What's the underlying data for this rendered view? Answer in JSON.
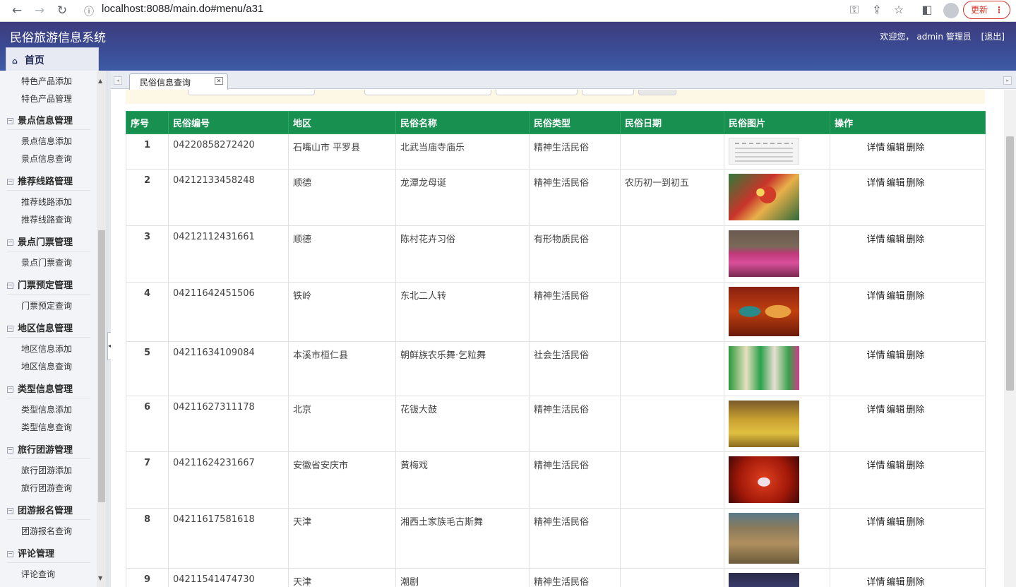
{
  "browser": {
    "url": "localhost:8088/main.do#menu/a31",
    "update_label": "更新"
  },
  "header": {
    "app_title": "民俗旅游信息系统",
    "welcome": "欢迎您，",
    "user": "admin 管理员",
    "logout": "[退出]",
    "home_tab": "首页"
  },
  "sidebar": {
    "items": [
      {
        "type": "item",
        "label": "特色产品添加"
      },
      {
        "type": "item",
        "label": "特色产品管理"
      },
      {
        "type": "group",
        "label": "景点信息管理"
      },
      {
        "type": "item",
        "label": "景点信息添加"
      },
      {
        "type": "item",
        "label": "景点信息查询"
      },
      {
        "type": "group",
        "label": "推荐线路管理"
      },
      {
        "type": "item",
        "label": "推荐线路添加"
      },
      {
        "type": "item",
        "label": "推荐线路查询"
      },
      {
        "type": "group",
        "label": "景点门票管理"
      },
      {
        "type": "item",
        "label": "景点门票查询"
      },
      {
        "type": "group",
        "label": "门票预定管理"
      },
      {
        "type": "item",
        "label": "门票预定查询"
      },
      {
        "type": "group",
        "label": "地区信息管理"
      },
      {
        "type": "item",
        "label": "地区信息添加"
      },
      {
        "type": "item",
        "label": "地区信息查询"
      },
      {
        "type": "group",
        "label": "类型信息管理"
      },
      {
        "type": "item",
        "label": "类型信息添加"
      },
      {
        "type": "item",
        "label": "类型信息查询"
      },
      {
        "type": "group",
        "label": "旅行团游管理"
      },
      {
        "type": "item",
        "label": "旅行团游添加"
      },
      {
        "type": "item",
        "label": "旅行团游查询"
      },
      {
        "type": "group",
        "label": "团游报名管理"
      },
      {
        "type": "item",
        "label": "团游报名查询"
      },
      {
        "type": "group",
        "label": "评论管理"
      },
      {
        "type": "item",
        "label": "评论查询"
      }
    ]
  },
  "content_tab": {
    "label": "民俗信息查询"
  },
  "table": {
    "columns": [
      "序号",
      "民俗编号",
      "地区",
      "民俗名称",
      "民俗类型",
      "民俗日期",
      "民俗图片",
      "操作"
    ],
    "actions": [
      "详情",
      "编辑",
      "删除"
    ],
    "rows": [
      {
        "idx": "1",
        "code": "04220858272420",
        "region": "石嘴山市 平罗县",
        "name": "北武当庙寺庙乐",
        "type": "精神生活民俗",
        "date": ""
      },
      {
        "idx": "2",
        "code": "04212133458248",
        "region": "顺德",
        "name": "龙潭龙母诞",
        "type": "精神生活民俗",
        "date": "农历初一到初五"
      },
      {
        "idx": "3",
        "code": "04212112431661",
        "region": "顺德",
        "name": "陈村花卉习俗",
        "type": "有形物质民俗",
        "date": ""
      },
      {
        "idx": "4",
        "code": "04211642451506",
        "region": "铁岭",
        "name": "东北二人转",
        "type": "精神生活民俗",
        "date": ""
      },
      {
        "idx": "5",
        "code": "04211634109084",
        "region": "本溪市桓仁县",
        "name": "朝鲜族农乐舞·乞粒舞",
        "type": "社会生活民俗",
        "date": ""
      },
      {
        "idx": "6",
        "code": "04211627311178",
        "region": "北京",
        "name": "花钹大鼓",
        "type": "精神生活民俗",
        "date": ""
      },
      {
        "idx": "7",
        "code": "04211624231667",
        "region": "安徽省安庆市",
        "name": "黄梅戏",
        "type": "精神生活民俗",
        "date": ""
      },
      {
        "idx": "8",
        "code": "04211617581618",
        "region": "天津",
        "name": "湘西土家族毛古斯舞",
        "type": "精神生活民俗",
        "date": ""
      },
      {
        "idx": "9",
        "code": "04211541474730",
        "region": "天津",
        "name": "潮剧",
        "type": "精神生活民俗",
        "date": ""
      }
    ]
  },
  "colors": {
    "header_bg": "#3a4a92",
    "table_header_bg": "#179050",
    "update_red": "#d93025"
  }
}
